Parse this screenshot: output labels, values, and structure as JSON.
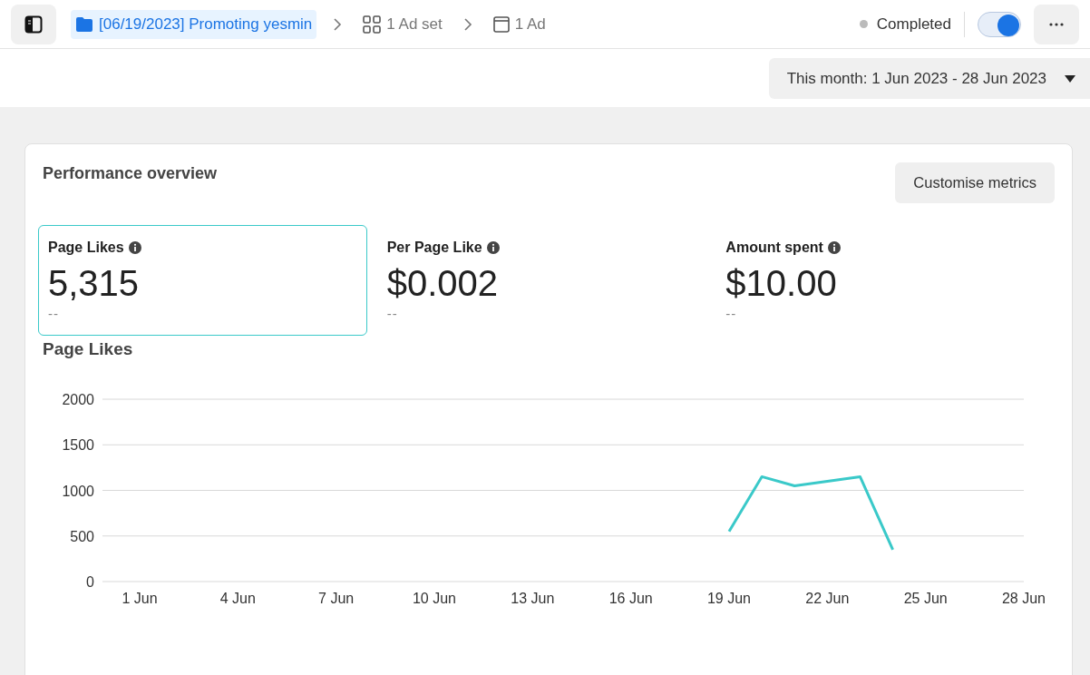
{
  "breadcrumb": [
    {
      "kind": "campaign",
      "label": "[06/19/2023] Promoting yesmin",
      "selected": true
    },
    {
      "kind": "adset",
      "label": "1 Ad set",
      "selected": false
    },
    {
      "kind": "ad",
      "label": "1 Ad",
      "selected": false
    }
  ],
  "status": {
    "label": "Completed",
    "on": true
  },
  "date_range": {
    "label": "This month: 1 Jun 2023 - 28 Jun 2023"
  },
  "performance": {
    "title": "Performance overview",
    "customise_button": "Customise metrics",
    "metrics": [
      {
        "label": "Page Likes",
        "value": "5,315",
        "comparison": "--",
        "selected": true
      },
      {
        "label": "Per Page Like",
        "value": "$0.002",
        "comparison": "--",
        "selected": false
      },
      {
        "label": "Amount spent",
        "value": "$10.00",
        "comparison": "--",
        "selected": false
      }
    ],
    "chart_title": "Page Likes",
    "chart_data": {
      "type": "line",
      "categories": [
        "1 Jun",
        null,
        null,
        "4 Jun",
        null,
        null,
        "7 Jun",
        null,
        null,
        "10 Jun",
        null,
        null,
        "13 Jun",
        null,
        null,
        "16 Jun",
        null,
        null,
        "19 Jun",
        null,
        null,
        "22 Jun",
        null,
        null,
        "25 Jun",
        null,
        null,
        "28 Jun"
      ],
      "series": [
        {
          "color": "#3ac9c9",
          "values": [
            null,
            null,
            null,
            null,
            null,
            null,
            null,
            null,
            null,
            null,
            null,
            null,
            null,
            null,
            null,
            null,
            null,
            null,
            550,
            1150,
            1050,
            1100,
            1150,
            350,
            null,
            null,
            null,
            null
          ]
        }
      ],
      "ylim": [
        0,
        2000
      ],
      "yticks": [
        0,
        500,
        1000,
        1500,
        2000
      ],
      "grid": true
    }
  }
}
